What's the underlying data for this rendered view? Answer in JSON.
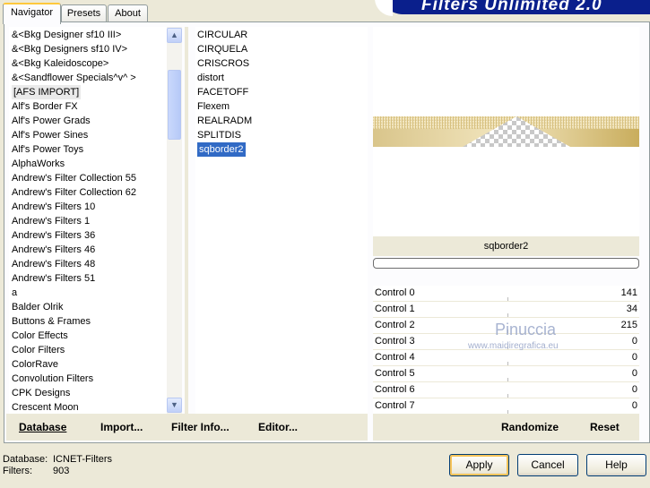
{
  "tabs": [
    "Navigator",
    "Presets",
    "About"
  ],
  "brand_title": "Filters Unlimited 2.0",
  "categories": [
    "&<Bkg Designer sf10 III>",
    "&<Bkg Designers sf10 IV>",
    "&<Bkg Kaleidoscope>",
    "&<Sandflower Specials^v^ >",
    "[AFS IMPORT]",
    "Alf's Border FX",
    "Alf's Power Grads",
    "Alf's Power Sines",
    "Alf's Power Toys",
    "AlphaWorks",
    "Andrew's Filter Collection 55",
    "Andrew's Filter Collection 62",
    "Andrew's Filters 10",
    "Andrew's Filters 1",
    "Andrew's Filters 36",
    "Andrew's Filters 46",
    "Andrew's Filters 48",
    "Andrew's Filters 51",
    "a",
    "Balder Olrik",
    "Buttons & Frames",
    "Color Effects",
    "Color Filters",
    "ColorRave",
    "Convolution Filters",
    "CPK Designs",
    "Crescent Moon"
  ],
  "filters": [
    "CIRCULAR",
    "CIRQUELA",
    "CRISCROS",
    "distort",
    "FACETOFF",
    "Flexem",
    "REALRADM",
    "SPLITDIS",
    "sqborder2"
  ],
  "selected_filter": "sqborder2",
  "controls": [
    {
      "label": "Control 0",
      "value": "141"
    },
    {
      "label": "Control 1",
      "value": "34"
    },
    {
      "label": "Control 2",
      "value": "215"
    },
    {
      "label": "Control 3",
      "value": "0"
    },
    {
      "label": "Control 4",
      "value": "0"
    },
    {
      "label": "Control 5",
      "value": "0"
    },
    {
      "label": "Control 6",
      "value": "0"
    },
    {
      "label": "Control 7",
      "value": "0"
    }
  ],
  "watermark": {
    "name": "Pinuccia",
    "site": "www.maidiregrafica.eu"
  },
  "bottom_buttons": {
    "database": "Database",
    "import": "Import...",
    "filter_info": "Filter Info...",
    "editor": "Editor...",
    "randomize": "Randomize",
    "reset": "Reset"
  },
  "footer": {
    "database_label": "Database:",
    "database_value": "ICNET-Filters",
    "filters_label": "Filters:",
    "filters_value": "903"
  },
  "dialog_buttons": {
    "apply": "Apply",
    "cancel": "Cancel",
    "help": "Help"
  },
  "colors": {
    "accent": "#316ac5",
    "brand": "#0a1f8c",
    "window_bg": "#ece9d8"
  }
}
